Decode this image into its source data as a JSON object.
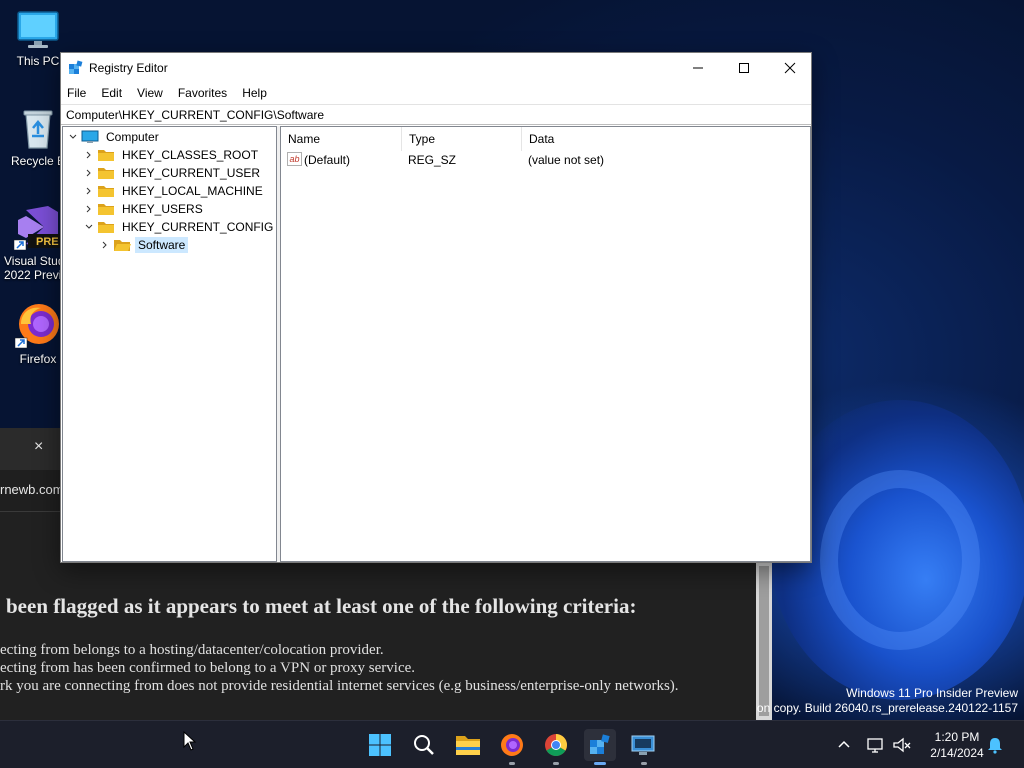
{
  "desktop": {
    "icons": [
      {
        "label": "This PC"
      },
      {
        "label": "Recycle B"
      },
      {
        "label_line1": "Visual Stud",
        "label_line2": "2022 Previ",
        "badge": "PRE"
      },
      {
        "label": "Firefox"
      }
    ],
    "watermark": {
      "line1": "Windows 11 Pro Insider Preview",
      "line2": "on copy. Build 26040.rs_prerelease.240122-1157"
    }
  },
  "background_browser": {
    "close_glyph": "×",
    "url_fragment": "rnewb.com",
    "heading": "been flagged as it appears to meet at least one of the following criteria:",
    "criteria": [
      "ecting from belongs to a hosting/datacenter/colocation provider.",
      "ecting from has been confirmed to belong to a VPN or proxy service.",
      "rk you are connecting from does not provide residential internet services (e.g business/enterprise-only networks)."
    ]
  },
  "regedit": {
    "title": "Registry Editor",
    "controls": {
      "minimize": "minimize-icon",
      "maximize": "maximize-icon",
      "close": "close-icon"
    },
    "menu": [
      "File",
      "Edit",
      "View",
      "Favorites",
      "Help"
    ],
    "address": "Computer\\HKEY_CURRENT_CONFIG\\Software",
    "tree": {
      "root": "Computer",
      "hives": [
        {
          "label": "HKEY_CLASSES_ROOT",
          "expanded": false
        },
        {
          "label": "HKEY_CURRENT_USER",
          "expanded": false
        },
        {
          "label": "HKEY_LOCAL_MACHINE",
          "expanded": false
        },
        {
          "label": "HKEY_USERS",
          "expanded": false
        },
        {
          "label": "HKEY_CURRENT_CONFIG",
          "expanded": true
        }
      ],
      "selected_child": "Software"
    },
    "columns": [
      "Name",
      "Type",
      "Data"
    ],
    "values": [
      {
        "icon": "ab",
        "name": "(Default)",
        "type": "REG_SZ",
        "data": "(value not set)"
      }
    ],
    "colors": {
      "selection": "#cce8ff",
      "folder": "#f4c430",
      "folder_dark": "#dca21b"
    }
  },
  "taskbar": {
    "icons": [
      "start-icon",
      "search-icon",
      "file-explorer-icon",
      "firefox-icon",
      "chrome-icon",
      "registry-editor-icon",
      "remote-desktop-icon"
    ],
    "clock": {
      "time": "1:20 PM",
      "date": "2/14/2024"
    }
  }
}
